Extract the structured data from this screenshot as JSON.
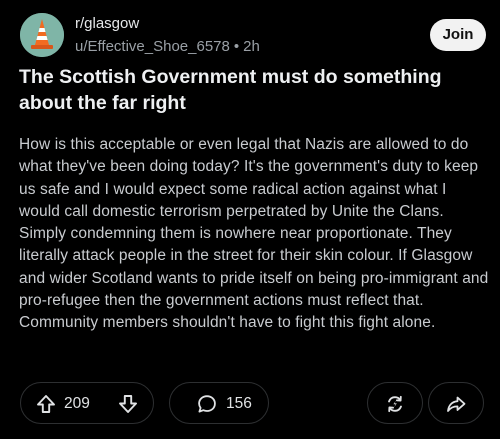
{
  "post": {
    "subreddit": "r/glasgow",
    "username": "u/Effective_Shoe_6578",
    "separator": "•",
    "age": "2h",
    "join_label": "Join",
    "title": "The Scottish Government must do something about the far right",
    "body": "How is this acceptable or even legal that Nazis are allowed to do what they've been doing today? It's the government's duty to keep us safe and I would expect some radical action against what I would call domestic terrorism perpetrated by Unite the Clans. Simply condemning them is nowhere near proportionate. They literally attack people in the street for their skin colour. If Glasgow and wider Scotland wants to pride itself on being pro-immigrant and pro-refugee then the government actions must reflect that. Community members shouldn't have to fight this fight alone."
  },
  "actions": {
    "vote_count": "209",
    "comment_count": "156"
  },
  "icons": {
    "avatar": "traffic-cone-avatar",
    "upvote": "arrow-up-icon",
    "downvote": "arrow-down-icon",
    "comment": "speech-bubble-icon",
    "award": "award-swap-icon",
    "share": "share-arrow-icon"
  },
  "colors": {
    "background": "#000000",
    "avatar_bg": "#7fb5a7",
    "cone": "#f26b21",
    "join_bg": "#f2f2f2"
  }
}
